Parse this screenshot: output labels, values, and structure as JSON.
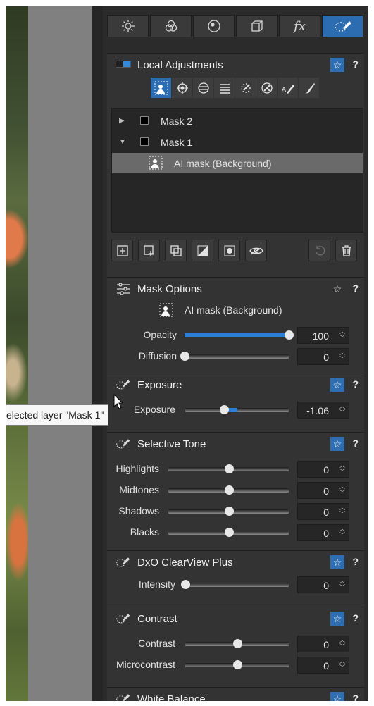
{
  "toolbar": {
    "tabs": [
      {
        "icon": "sun-icon"
      },
      {
        "icon": "color-circles-icon"
      },
      {
        "icon": "lens-icon"
      },
      {
        "icon": "geometry-cube-icon"
      },
      {
        "icon": "fx-icon",
        "label": "fx"
      },
      {
        "icon": "local-adjust-brush-icon"
      }
    ]
  },
  "local_adjustments": {
    "title": "Local Adjustments",
    "masks": [
      {
        "label": "Mask 2",
        "expanded": false
      },
      {
        "label": "Mask 1",
        "expanded": true
      },
      {
        "label": "AI mask (Background)",
        "selected": true
      }
    ]
  },
  "mask_options": {
    "title": "Mask Options",
    "mask_name": "AI mask (Background)",
    "opacity": {
      "label": "Opacity",
      "value": "100",
      "level": 1.0
    },
    "diffusion": {
      "label": "Diffusion",
      "value": "0",
      "level": 0.0
    }
  },
  "exposure": {
    "title": "Exposure",
    "label": "Exposure",
    "value": "-1.06",
    "level": 0.37
  },
  "tooltip": "elected layer \"Mask 1\"",
  "selective_tone": {
    "title": "Selective Tone",
    "rows": [
      {
        "label": "Highlights",
        "value": "0"
      },
      {
        "label": "Midtones",
        "value": "0"
      },
      {
        "label": "Shadows",
        "value": "0"
      },
      {
        "label": "Blacks",
        "value": "0"
      }
    ]
  },
  "clearview": {
    "title": "DxO ClearView Plus",
    "label": "Intensity",
    "value": "0"
  },
  "contrast": {
    "title": "Contrast",
    "rows": [
      {
        "label": "Contrast",
        "value": "0"
      },
      {
        "label": "Microcontrast",
        "value": "0"
      }
    ]
  },
  "white_balance": {
    "title": "White Balance"
  },
  "colors": {
    "accent": "#2b6db0",
    "panel": "#333333"
  }
}
